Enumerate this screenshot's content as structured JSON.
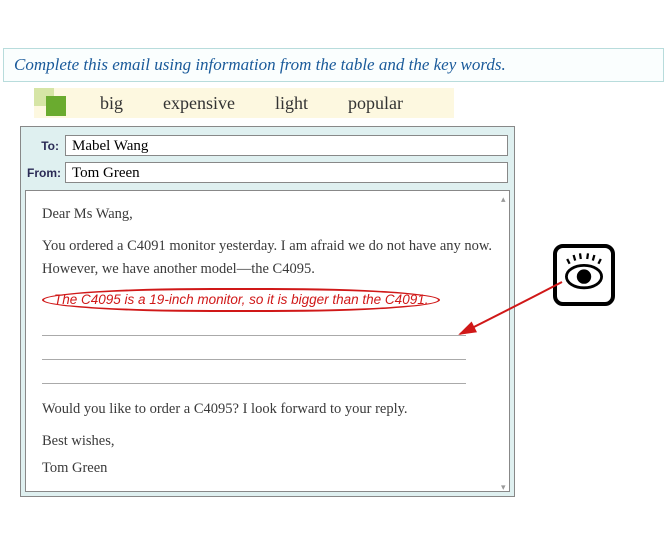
{
  "instruction": "Complete this email using information from the table and the key words.",
  "keywords": [
    "big",
    "expensive",
    "light",
    "popular"
  ],
  "email": {
    "to_label": "To:",
    "from_label": "From:",
    "to": "Mabel Wang",
    "from": "Tom Green",
    "greeting": "Dear Ms Wang,",
    "para1": "You ordered a C4091 monitor yesterday. I am afraid we do not have any now. However, we have another model—the C4095.",
    "answer": "The C4095 is a 19-inch monitor, so it is bigger than the C4091.",
    "closing_question": "Would you like to order a C4095? I look forward to your reply.",
    "bestwishes": "Best wishes,",
    "signature": "Tom Green"
  }
}
